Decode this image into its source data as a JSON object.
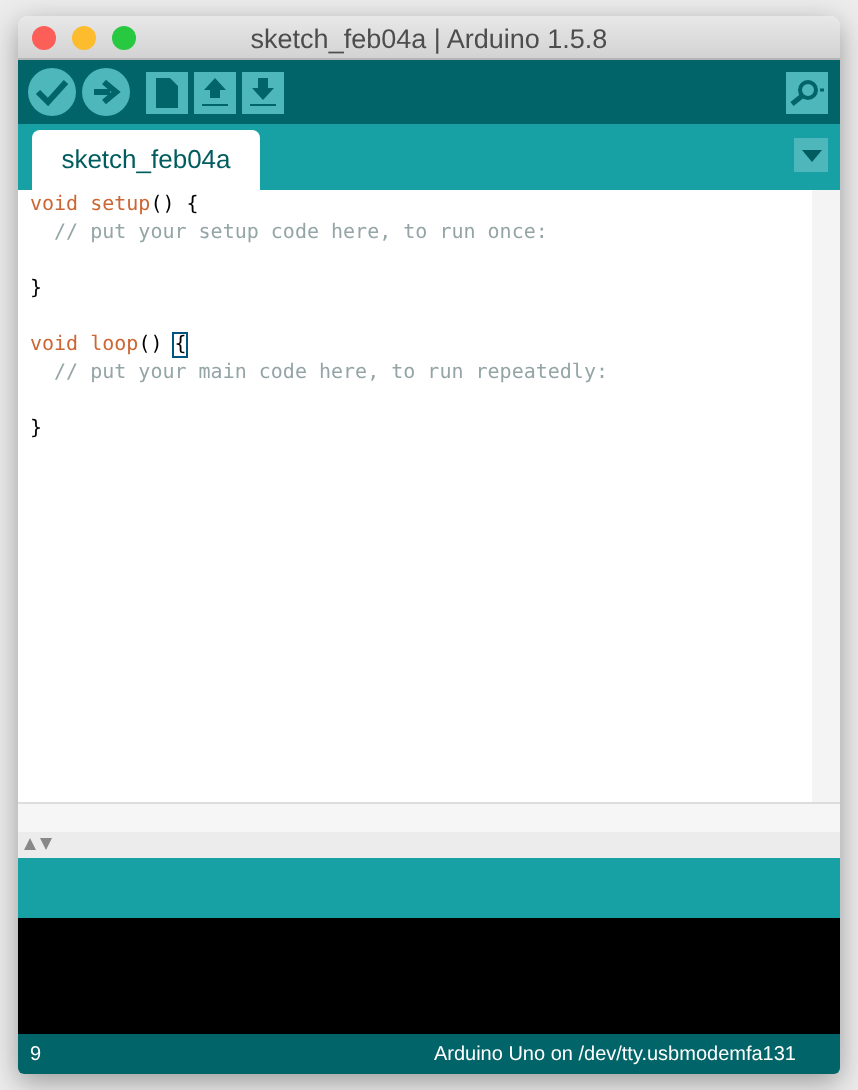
{
  "window": {
    "title": "sketch_feb04a | Arduino 1.5.8"
  },
  "toolbar": {
    "buttons": [
      {
        "kind": "verify"
      },
      {
        "kind": "upload"
      },
      {
        "kind": "new"
      },
      {
        "kind": "open"
      },
      {
        "kind": "save"
      }
    ],
    "serial_monitor": {
      "kind": "monitor"
    }
  },
  "tabs": [
    {
      "label": "sketch_feb04a",
      "selected": true
    }
  ],
  "editor": {
    "lines": [
      {
        "kind": "code",
        "segments": [
          {
            "text": "void setup",
            "kind": "keyword"
          },
          {
            "text": "() {",
            "kind": "plain"
          }
        ]
      },
      {
        "kind": "code",
        "segments": [
          {
            "text": "  // put your setup code here, to run once:",
            "kind": "comment"
          }
        ]
      },
      {
        "kind": "blank"
      },
      {
        "kind": "code",
        "segments": [
          {
            "text": "}",
            "kind": "plain"
          }
        ]
      },
      {
        "kind": "blank"
      },
      {
        "kind": "code",
        "segments": [
          {
            "text": "void loop",
            "kind": "keyword"
          },
          {
            "text": "() ",
            "kind": "plain"
          },
          {
            "text": "{",
            "kind": "match"
          }
        ]
      },
      {
        "kind": "code",
        "segments": [
          {
            "text": "  // put your main code here, to run repeatedly:",
            "kind": "comment"
          }
        ]
      },
      {
        "kind": "blank"
      },
      {
        "kind": "code",
        "segments": [
          {
            "text": "}",
            "kind": "plain"
          }
        ]
      }
    ]
  },
  "status_bar": {
    "line": "9",
    "board": "Arduino Uno on /dev/tty.usbmodemfa131"
  }
}
